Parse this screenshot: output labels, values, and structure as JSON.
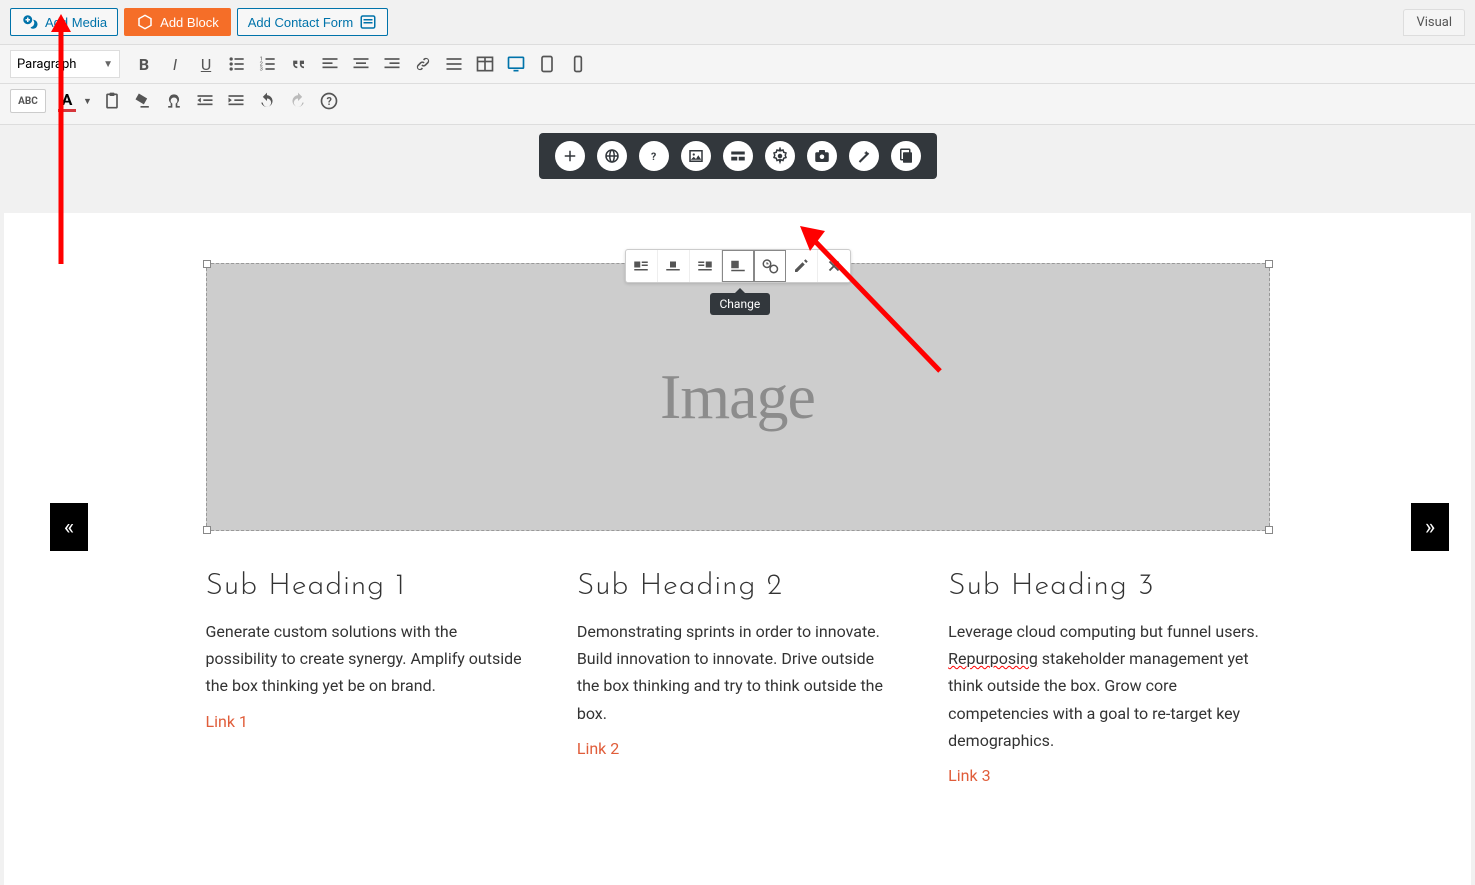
{
  "topbar": {
    "add_media": "Add Media",
    "add_block": "Add Block",
    "add_contact_form": "Add Contact Form",
    "visual_tab": "Visual"
  },
  "toolbar": {
    "format_select": "Paragraph"
  },
  "tooltip_change": "Change",
  "image_placeholder": "Image",
  "columns": [
    {
      "heading": "Sub Heading 1",
      "text": "Generate custom solutions with the possibility to create synergy. Amplify outside the box thinking yet be on brand.",
      "link": "Link 1"
    },
    {
      "heading": "Sub Heading 2",
      "text": "Demonstrating sprints in order to innovate. Build innovation to innovate. Drive outside the box thinking and try to think outside the box.",
      "link": "Link 2"
    },
    {
      "heading": "Sub Heading 3",
      "text_prefix": "Leverage cloud computing but funnel users. ",
      "spell": "Repurposing",
      "text_suffix": " stakeholder management yet think outside the box. Grow core competencies with a goal to re-target key demographics.",
      "link": "Link 3"
    }
  ]
}
